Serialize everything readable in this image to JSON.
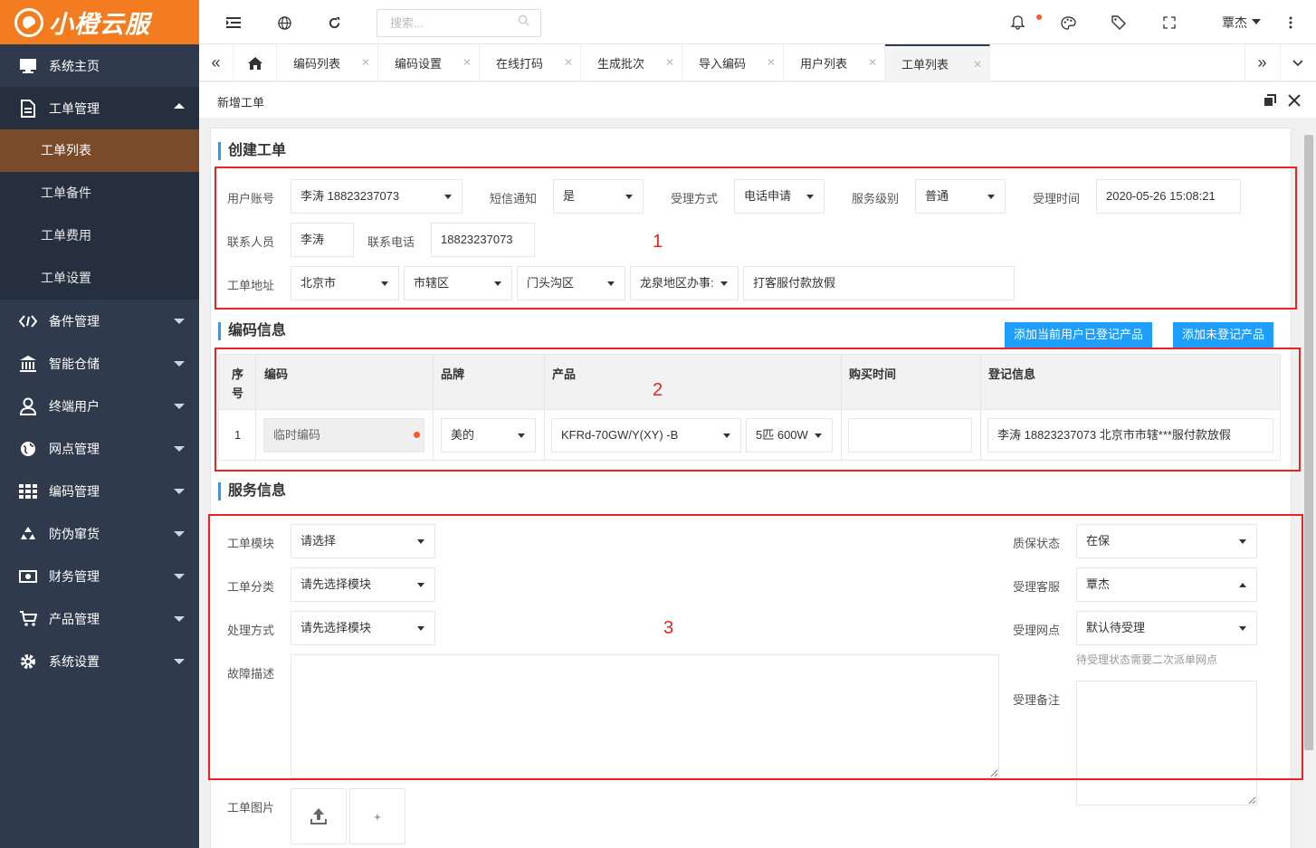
{
  "brand": {
    "name": "小橙云服"
  },
  "sidebar": {
    "items": [
      {
        "label": "系统主页",
        "icon": "monitor-icon"
      },
      {
        "label": "工单管理",
        "icon": "document-icon",
        "open": true,
        "children": [
          {
            "label": "工单列表",
            "active": true
          },
          {
            "label": "工单备件"
          },
          {
            "label": "工单费用"
          },
          {
            "label": "工单设置"
          }
        ]
      },
      {
        "label": "备件管理",
        "icon": "code-icon"
      },
      {
        "label": "智能仓储",
        "icon": "bank-icon"
      },
      {
        "label": "终端用户",
        "icon": "user-icon"
      },
      {
        "label": "网点管理",
        "icon": "globe-icon"
      },
      {
        "label": "编码管理",
        "icon": "grid-icon"
      },
      {
        "label": "防伪窜货",
        "icon": "recycle-icon"
      },
      {
        "label": "财务管理",
        "icon": "money-icon"
      },
      {
        "label": "产品管理",
        "icon": "cart-icon"
      },
      {
        "label": "系统设置",
        "icon": "gear-icon"
      }
    ]
  },
  "topbar": {
    "search_placeholder": "搜索...",
    "user": "覃杰"
  },
  "tabs": [
    {
      "label": "编码列表"
    },
    {
      "label": "编码设置"
    },
    {
      "label": "在线打码"
    },
    {
      "label": "生成批次"
    },
    {
      "label": "导入编码"
    },
    {
      "label": "用户列表"
    },
    {
      "label": "工单列表",
      "active": true
    }
  ],
  "page": {
    "title": "新增工单"
  },
  "create": {
    "title": "创建工单",
    "account_label": "用户账号",
    "account_value": "李涛 18823237073",
    "sms_label": "短信通知",
    "sms_value": "是",
    "method_label": "受理方式",
    "method_value": "电话申请",
    "level_label": "服务级别",
    "level_value": "普通",
    "time_label": "受理时间",
    "time_value": "2020-05-26 15:08:21",
    "contact_label": "联系人员",
    "contact_value": "李涛",
    "phone_label": "联系电话",
    "phone_value": "18823237073",
    "address_label": "工单地址",
    "province": "北京市",
    "city": "市辖区",
    "district": "门头沟区",
    "street": "龙泉地区办事:",
    "address_detail": "打客服付款放假",
    "marker": "1"
  },
  "codes": {
    "title": "编码信息",
    "btn_registered": "添加当前用户已登记产品",
    "btn_unregistered": "添加未登记产品",
    "headers": {
      "seq": "序号",
      "code": "编码",
      "brand": "品牌",
      "product": "产品",
      "buy_time": "购买时间",
      "reg_info": "登记信息"
    },
    "row": {
      "seq": "1",
      "code": "临时编码",
      "brand": "美的",
      "product": "KFRd-70GW/Y(XY) -B",
      "spec": "5匹 600W",
      "buy_time": "",
      "reg_info": "李涛 18823237073 北京市市辖***服付款放假"
    },
    "marker": "2"
  },
  "service": {
    "title": "服务信息",
    "module_label": "工单模块",
    "module_value": "请选择",
    "category_label": "工单分类",
    "category_value": "请先选择模块",
    "handle_label": "处理方式",
    "handle_value": "请先选择模块",
    "fault_label": "故障描述",
    "warranty_label": "质保状态",
    "warranty_value": "在保",
    "agent_label": "受理客服",
    "agent_value": "覃杰",
    "site_label": "受理网点",
    "site_value": "默认待受理",
    "site_hint": "待受理状态需要二次派单网点",
    "remark_label": "受理备注",
    "image_label": "工单图片",
    "add_symbol": "+",
    "marker": "3"
  },
  "colors": {
    "accent": "#1e9fff",
    "brand": "#f47c20",
    "sidebar": "#2f3a4c",
    "annotation": "#e82424"
  }
}
